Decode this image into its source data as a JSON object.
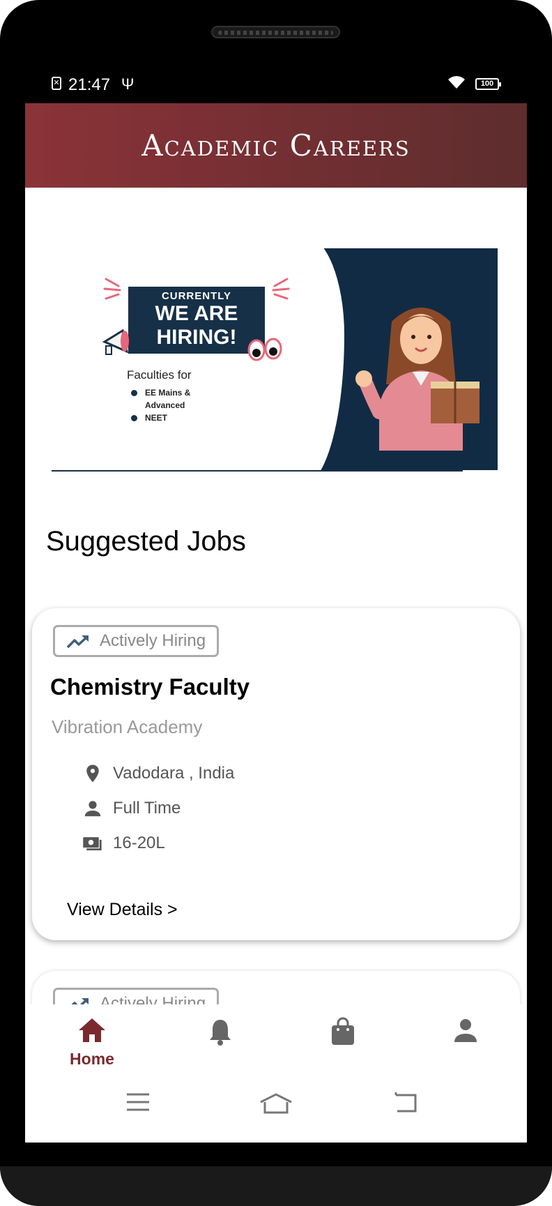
{
  "status_bar": {
    "time": "21:47",
    "battery": "100",
    "sim_glyph": "✕",
    "usb_glyph": "Ψ"
  },
  "app": {
    "title": "Academic Careers"
  },
  "banner": {
    "currently": "CURRENTLY",
    "we_are": "WE ARE",
    "hiring": "HIRING!",
    "faculties_for": "Faculties for",
    "items": [
      "EE Mains &",
      "Advanced",
      "NEET"
    ]
  },
  "section": {
    "title": "Suggested Jobs"
  },
  "jobs": [
    {
      "badge": "Actively Hiring",
      "title": "Chemistry Faculty",
      "company": "Vibration Academy",
      "location": "Vadodara , India",
      "job_type": "Full Time",
      "salary": "16-20L",
      "view_details": "View Details >"
    },
    {
      "badge": "Actively Hiring"
    }
  ],
  "bottom_nav": {
    "items": [
      {
        "label": "Home",
        "icon": "home-icon",
        "active": true
      },
      {
        "label": "",
        "icon": "bell-icon",
        "active": false
      },
      {
        "label": "",
        "icon": "shopping-bag-icon",
        "active": false
      },
      {
        "label": "",
        "icon": "person-icon",
        "active": false
      }
    ]
  },
  "colors": {
    "primary": "#7a2a2e",
    "appbar_start": "#8b3338",
    "appbar_end": "#5e2d2e",
    "banner_navy": "#122b44"
  }
}
